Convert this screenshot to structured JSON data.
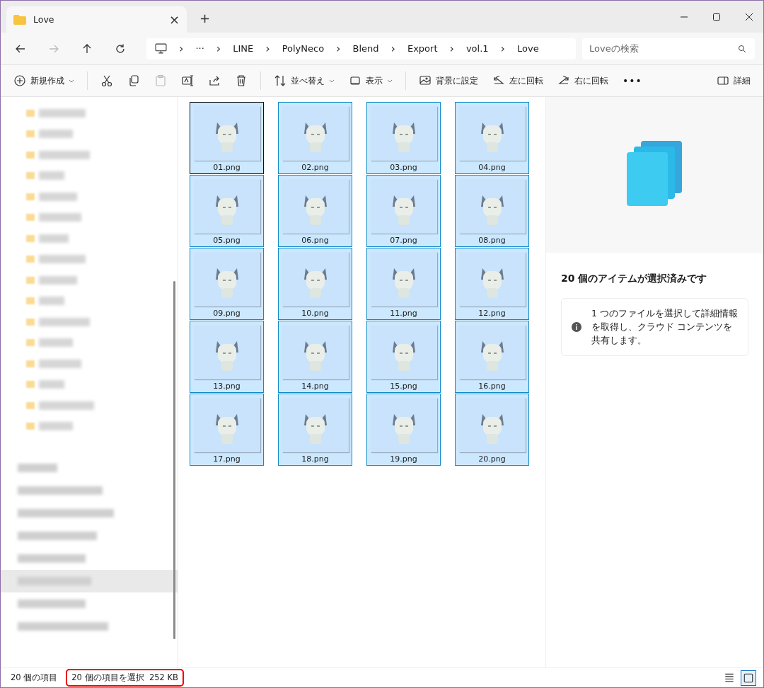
{
  "tab": {
    "title": "Love",
    "close": "×",
    "new_tab": "+"
  },
  "address": {
    "overflow": "···",
    "separators": [
      "›",
      "›",
      "›",
      "›",
      "›",
      "›",
      "›"
    ],
    "crumbs": [
      "LINE",
      "PolyNeco",
      "Blend",
      "Export",
      "vol.1",
      "Love"
    ],
    "search_placeholder": "Loveの検索"
  },
  "toolbar": [
    {
      "kind": "new",
      "label": "新規作成",
      "dropdown": true
    },
    {
      "kind": "cut",
      "disabled": false
    },
    {
      "kind": "copy",
      "disabled": false
    },
    {
      "kind": "paste",
      "disabled": true
    },
    {
      "kind": "rename",
      "disabled": false
    },
    {
      "kind": "share",
      "disabled": false
    },
    {
      "kind": "delete",
      "disabled": false
    },
    {
      "kind": "sort",
      "label": "並べ替え",
      "dropdown": true
    },
    {
      "kind": "view",
      "label": "表示",
      "dropdown": true
    },
    {
      "kind": "wallpaper",
      "label": "背景に設定",
      "dropdown": false
    },
    {
      "kind": "rotate-left",
      "label": "左に回転",
      "dropdown": false
    },
    {
      "kind": "rotate-right",
      "label": "右に回転",
      "dropdown": false
    },
    {
      "kind": "more",
      "label": "•••",
      "dropdown": false
    },
    {
      "kind": "details",
      "label": "詳細",
      "dropdown": false
    }
  ],
  "files": [
    {
      "name": "01.png",
      "selected": true,
      "focused": true
    },
    {
      "name": "02.png",
      "selected": true,
      "focused": false
    },
    {
      "name": "03.png",
      "selected": true,
      "focused": false
    },
    {
      "name": "04.png",
      "selected": true,
      "focused": false
    },
    {
      "name": "05.png",
      "selected": true,
      "focused": false
    },
    {
      "name": "06.png",
      "selected": true,
      "focused": false
    },
    {
      "name": "07.png",
      "selected": true,
      "focused": false
    },
    {
      "name": "08.png",
      "selected": true,
      "focused": false
    },
    {
      "name": "09.png",
      "selected": true,
      "focused": false
    },
    {
      "name": "10.png",
      "selected": true,
      "focused": false
    },
    {
      "name": "11.png",
      "selected": true,
      "focused": false
    },
    {
      "name": "12.png",
      "selected": true,
      "focused": false
    },
    {
      "name": "13.png",
      "selected": true,
      "focused": false
    },
    {
      "name": "14.png",
      "selected": true,
      "focused": false
    },
    {
      "name": "15.png",
      "selected": true,
      "focused": false
    },
    {
      "name": "16.png",
      "selected": true,
      "focused": false
    },
    {
      "name": "17.png",
      "selected": true,
      "focused": false
    },
    {
      "name": "18.png",
      "selected": true,
      "focused": false
    },
    {
      "name": "19.png",
      "selected": true,
      "focused": false
    },
    {
      "name": "20.png",
      "selected": true,
      "focused": false
    }
  ],
  "details_pane": {
    "heading": "20 個のアイテムが選択済みです",
    "info": "1 つのファイルを選択して詳細情報を取得し、クラウド コンテンツを共有します。"
  },
  "status_bar": {
    "count": "20 個の項目",
    "selection": "20 個の項目を選択  252 KB",
    "view_buttons": [
      {
        "kind": "details",
        "selected": false
      },
      {
        "kind": "tiles",
        "selected": true
      }
    ]
  }
}
